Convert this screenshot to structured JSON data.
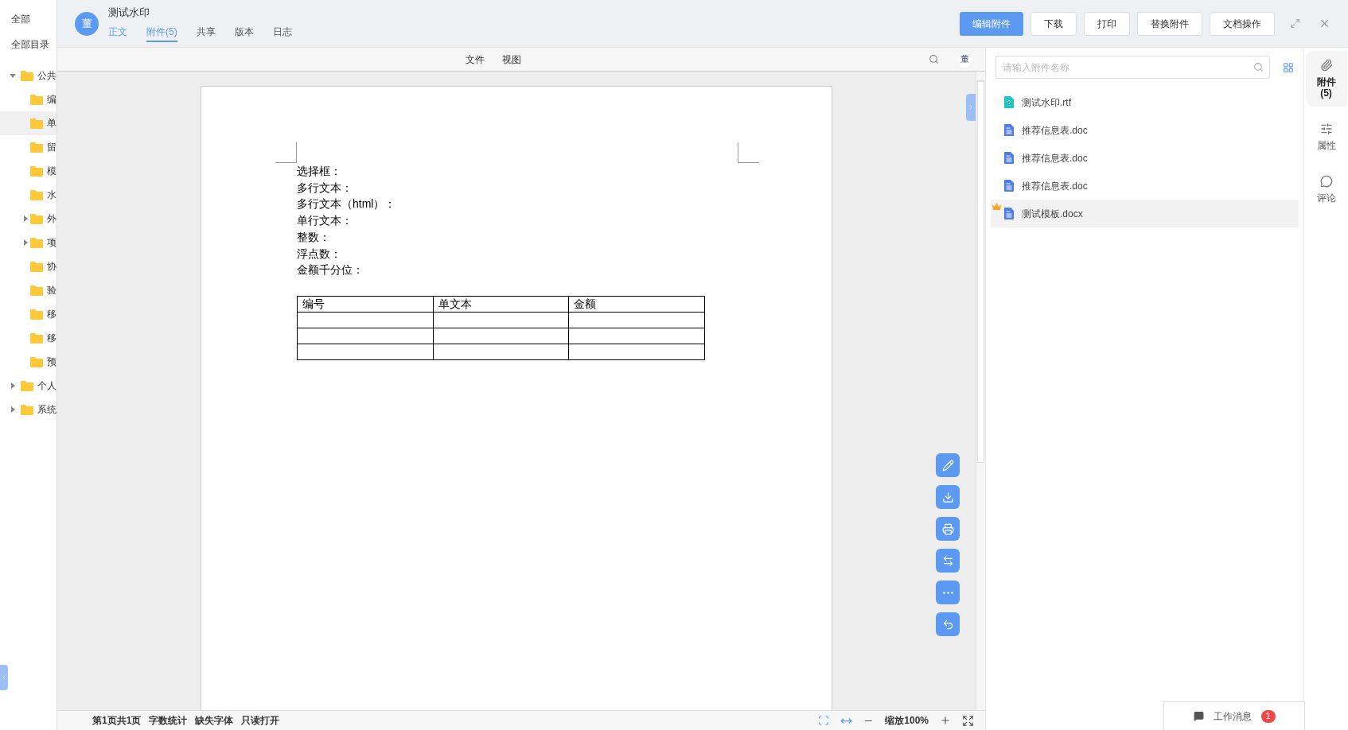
{
  "sidebar": {
    "items": [
      {
        "label": "全部"
      },
      {
        "label": "全部目录"
      }
    ],
    "tree": [
      {
        "label": "公共",
        "expanded": true,
        "selected": false,
        "children": [
          {
            "label": "编",
            "selected": false
          },
          {
            "label": "单",
            "selected": true
          },
          {
            "label": "留",
            "selected": false
          },
          {
            "label": "模",
            "selected": false
          },
          {
            "label": "水",
            "selected": false
          },
          {
            "label": "外",
            "expanded": false,
            "selected": false
          },
          {
            "label": "项",
            "expanded": false,
            "selected": false
          },
          {
            "label": "协",
            "selected": false
          },
          {
            "label": "验",
            "selected": false
          },
          {
            "label": "移",
            "selected": false
          },
          {
            "label": "移",
            "selected": false
          },
          {
            "label": "预",
            "selected": false
          }
        ]
      },
      {
        "label": "个人",
        "expanded": false,
        "selected": false
      },
      {
        "label": "系统",
        "expanded": false,
        "selected": false
      }
    ]
  },
  "header": {
    "avatar": "董",
    "title": "测试水印",
    "tabs": [
      {
        "label": "正文",
        "selected": false
      },
      {
        "label": "附件(5)",
        "selected": true
      },
      {
        "label": "共享",
        "selected": false
      },
      {
        "label": "版本",
        "selected": false
      },
      {
        "label": "日志",
        "selected": false
      }
    ],
    "buttons": [
      {
        "label": "编辑附件",
        "primary": true
      },
      {
        "label": "下载",
        "primary": false
      },
      {
        "label": "打印",
        "primary": false
      },
      {
        "label": "替换附件",
        "primary": false
      },
      {
        "label": "文档操作",
        "primary": false
      }
    ]
  },
  "viewer": {
    "menus": [
      "文件",
      "视图"
    ],
    "user": "董",
    "document": {
      "lines": [
        "选择框：",
        "多行文本：",
        "多行文本（html）：",
        "单行文本：",
        "整数：",
        "浮点数：",
        "金额千分位："
      ],
      "table": {
        "columns": [
          "编号",
          "单文本",
          "金额"
        ]
      }
    },
    "float_buttons": [
      {
        "kind": "edit"
      },
      {
        "kind": "download"
      },
      {
        "kind": "print"
      },
      {
        "kind": "swap"
      },
      {
        "kind": "more"
      },
      {
        "kind": "back"
      }
    ],
    "status_bar": {
      "items": [
        "第1页共1页",
        "字数统计",
        "缺失字体",
        "只读打开"
      ],
      "zoom": "缩放100%"
    }
  },
  "attachments": {
    "search": {
      "placeholder": "请输入附件名称"
    },
    "files": [
      {
        "name": "测试水印.rtf",
        "kind": "unknown",
        "selected": false,
        "starred": false
      },
      {
        "name": "推荐信息表.doc",
        "kind": "word",
        "selected": false,
        "starred": false
      },
      {
        "name": "推荐信息表.doc",
        "kind": "word",
        "selected": false,
        "starred": false
      },
      {
        "name": "推荐信息表.doc",
        "kind": "word",
        "selected": false,
        "starred": false
      },
      {
        "name": "测试模板.docx",
        "kind": "word",
        "selected": true,
        "starred": true
      }
    ]
  },
  "rail": [
    {
      "label": "附件\n(5)",
      "kind": "attach",
      "selected": true
    },
    {
      "label": "属性",
      "kind": "props",
      "selected": false
    },
    {
      "label": "评论",
      "kind": "comment",
      "selected": false
    }
  ],
  "messages": {
    "label": "工作消息",
    "count": "1"
  }
}
